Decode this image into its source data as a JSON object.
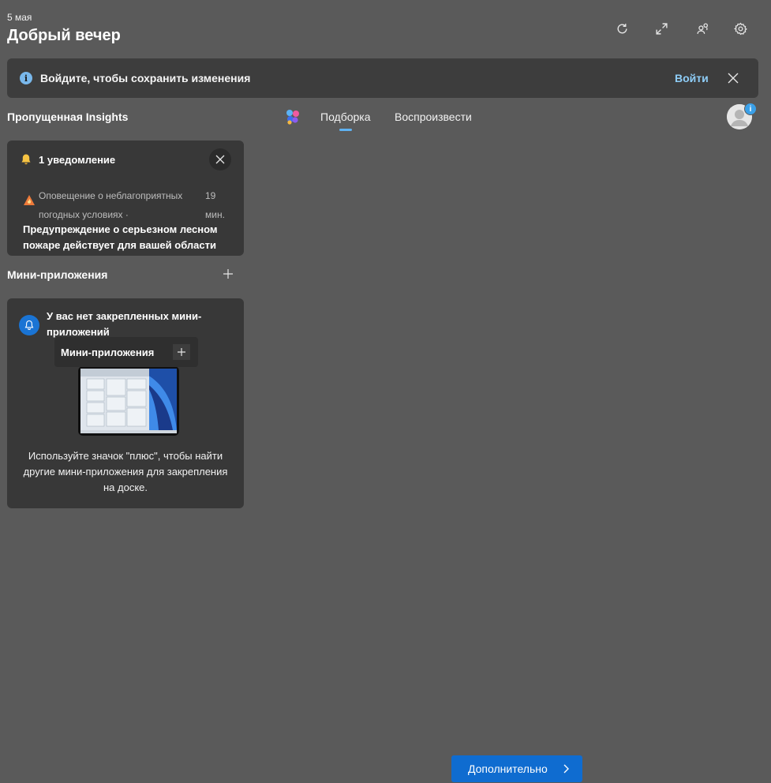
{
  "header": {
    "date": "5 мая",
    "greeting": "Добрый вечер",
    "buttons": [
      "refresh-icon",
      "expand-icon",
      "personalize-icon",
      "gear-icon"
    ]
  },
  "banner": {
    "text": "Войдите, чтобы сохранить изменения",
    "signin_label": "Войти",
    "info_glyph": "i"
  },
  "insights": {
    "title": "Пропущенная Insights",
    "notification": {
      "count_label": "1 уведомление",
      "source": "Оповещение о неблагоприятных погодных условиях ·",
      "time": "19 мин.",
      "headline": "Предупреждение о серьезном лесном пожаре действует для вашей области"
    }
  },
  "widgets": {
    "title": "Мини-приложения",
    "empty_title": "У вас нет закрепленных мини-приложений",
    "popup_label": "Мини-приложения",
    "description": "Используйте значок \"плюс\", чтобы найти другие мини-приложения для закрепления на доске."
  },
  "feed": {
    "tabs": [
      "Подборка",
      "Воспроизвести"
    ],
    "active_tab": "Подборка",
    "avatar_badge": "i"
  },
  "footer": {
    "more_label": "Дополнительно"
  },
  "colors": {
    "background": "#5a5a5a",
    "card": "#383838",
    "accent": "#0f6cd0",
    "link": "#8ecdf7"
  }
}
